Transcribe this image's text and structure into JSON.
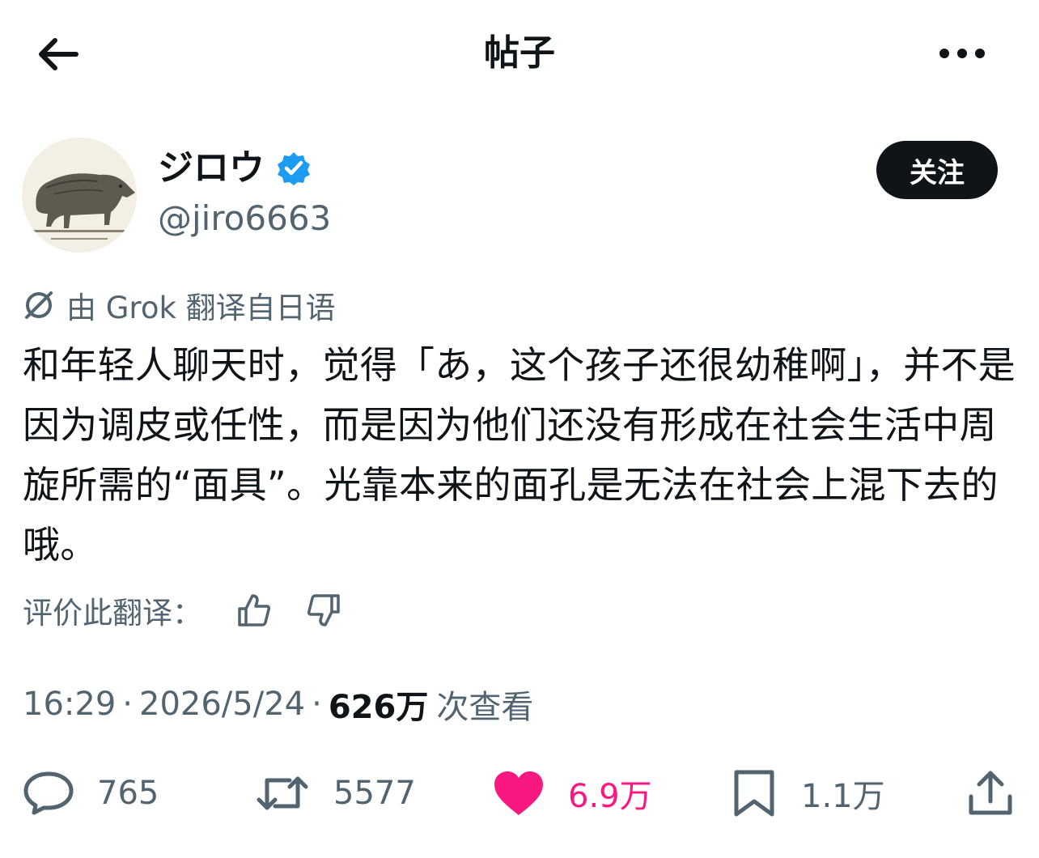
{
  "header": {
    "title": "帖子"
  },
  "author": {
    "display_name": "ジロウ",
    "handle": "@jiro6663",
    "verified": true,
    "follow_label": "关注"
  },
  "translation": {
    "note": "由 Grok 翻译自日语",
    "rate_label": "评价此翻译："
  },
  "post": {
    "text": "和年轻人聊天时，觉得「あ，这个孩子还很幼稚啊」，并不是因为调皮或任性，而是因为他们还没有形成在社会生活中周旋所需的“面具”。光靠本来的面孔是无法在社会上混下去的哦。",
    "time": "16:29",
    "date": "2026/5/24",
    "views": "626万",
    "views_label": "次查看"
  },
  "actions": {
    "replies": "765",
    "reposts": "5577",
    "likes": "6.9万",
    "bookmarks": "1.1万"
  },
  "colors": {
    "like": "#f91880",
    "verified": "#1d9bf0",
    "text": "#0f1419",
    "secondary": "#536471"
  },
  "icons": [
    "back-arrow-icon",
    "more-icon",
    "verified-icon",
    "grok-icon",
    "thumbs-up-icon",
    "thumbs-down-icon",
    "reply-icon",
    "repost-icon",
    "heart-icon",
    "bookmark-icon",
    "share-icon"
  ]
}
